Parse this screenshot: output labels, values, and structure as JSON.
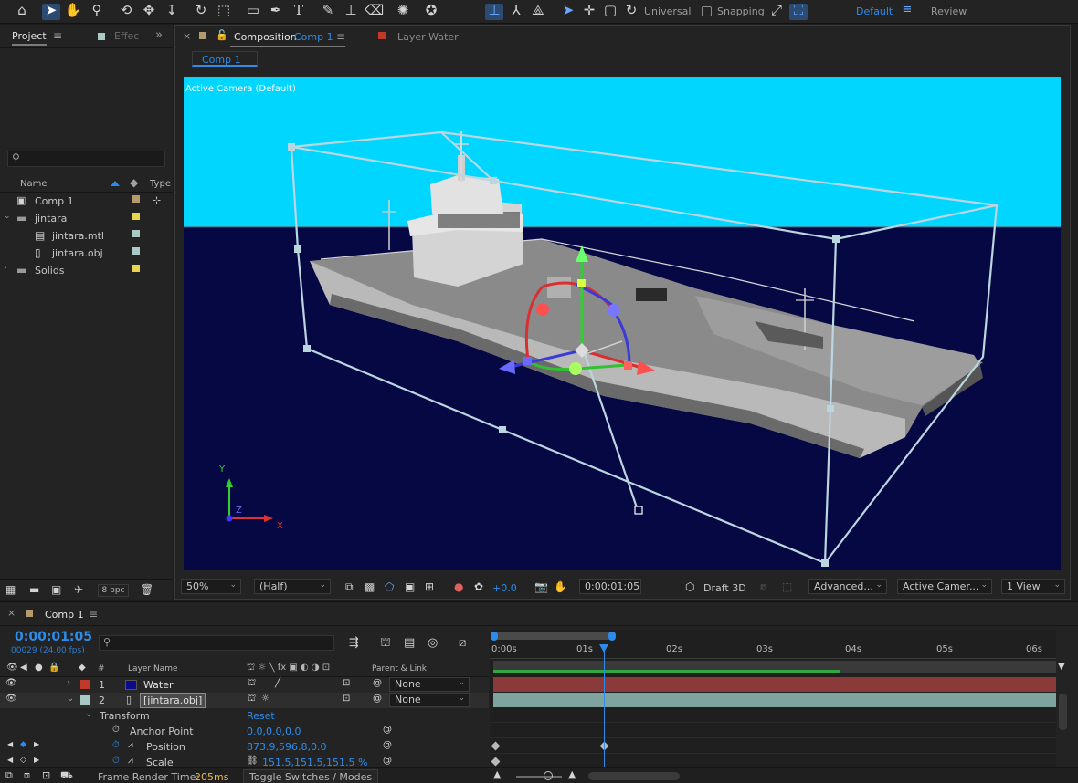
{
  "toolbar": {
    "universal_label": "Universal",
    "snapping_label": "Snapping",
    "workspaces": [
      "Default",
      "Review"
    ]
  },
  "project_panel": {
    "tab_project": "Project",
    "tab_effects": "Effec",
    "search_placeholder": "",
    "col_name": "Name",
    "col_type": "Type",
    "items": [
      {
        "name": "Comp 1",
        "color": "#b59a6e"
      },
      {
        "name": "jintara",
        "color": "#e8d44d"
      },
      {
        "name": "jintara.mtl",
        "color": "#a9c9c4"
      },
      {
        "name": "jintara.obj",
        "color": "#a9c9c4"
      },
      {
        "name": "Solids",
        "color": "#e8d44d"
      }
    ],
    "bpc_label": "8 bpc"
  },
  "comp_panel": {
    "tab_prefix": "Composition",
    "tab_comp": "Comp 1",
    "tab_layer": "Layer Water",
    "subtab": "Comp 1",
    "camera_label": "Active Camera (Default)",
    "axis_labels": {
      "x": "X",
      "y": "Y",
      "z": "Z"
    },
    "zoom": "50%",
    "resolution": "(Half)",
    "exposure": "+0.0",
    "timecode": "0:00:01:05",
    "draft3d": "Draft 3D",
    "renderer": "Advanced...",
    "camera_select": "Active Camer...",
    "views": "1 View",
    "colors": {
      "sky": "#00d6ff",
      "water": "#060844"
    }
  },
  "timeline": {
    "tab": "Comp 1",
    "timecode": "0:00:01:05",
    "frames": "00029 (24.00 fps)",
    "col_layer_name": "Layer Name",
    "col_parent": "Parent & Link",
    "ruler": [
      "0:00s",
      "01s",
      "02s",
      "03s",
      "04s",
      "05s",
      "06s"
    ],
    "layers": [
      {
        "index": "1",
        "name": "Water",
        "parent": "None",
        "color": "#c0392b"
      },
      {
        "index": "2",
        "name": "[jintara.obj]",
        "parent": "None",
        "color": "#a9c9c4"
      }
    ],
    "transform_label": "Transform",
    "reset_label": "Reset",
    "properties": [
      {
        "name": "Anchor Point",
        "value": "0.0,0.0,0.0"
      },
      {
        "name": "Position",
        "value": "873.9,596.8,0.0"
      },
      {
        "name": "Scale",
        "value": "151.5,151.5,151.5 %"
      }
    ],
    "frame_render_label": "Frame Render Time:",
    "frame_render_value": "205ms",
    "toggle_label": "Toggle Switches / Modes"
  }
}
